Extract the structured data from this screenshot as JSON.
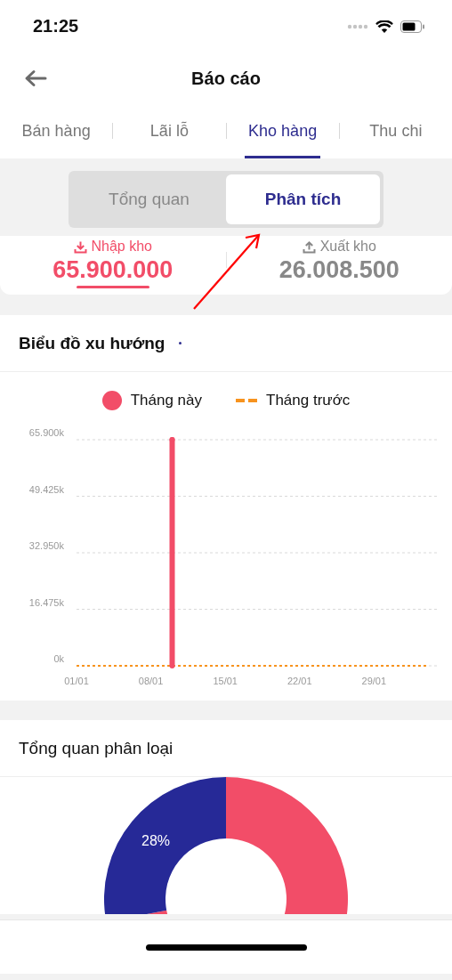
{
  "status_bar": {
    "time": "21:25"
  },
  "header": {
    "title": "Báo cáo"
  },
  "tabs": [
    {
      "label": "Bán hàng",
      "selected": false
    },
    {
      "label": "Lãi lỗ",
      "selected": false
    },
    {
      "label": "Kho hàng",
      "selected": true
    },
    {
      "label": "Thu chi",
      "selected": false
    }
  ],
  "segments": [
    {
      "label": "Tổng quan",
      "selected": false
    },
    {
      "label": "Phân tích",
      "selected": true
    }
  ],
  "summary": [
    {
      "kind": "import",
      "label": "Nhập kho",
      "value": "65.900.000",
      "selected": true
    },
    {
      "kind": "export",
      "label": "Xuất kho",
      "value": "26.008.500",
      "selected": false
    }
  ],
  "trend": {
    "title": "Biểu đồ xu hướng",
    "chart_data": {
      "type": "line",
      "categories": [
        "01/01",
        null,
        null,
        null,
        null,
        null,
        null,
        "08/01",
        null,
        null,
        null,
        null,
        null,
        null,
        "15/01",
        null,
        null,
        null,
        null,
        null,
        null,
        "22/01",
        null,
        null,
        null,
        null,
        null,
        null,
        "29/01",
        null,
        null,
        null,
        null,
        null
      ],
      "series": [
        {
          "name": "Tháng này",
          "color": "#f24d68",
          "line_style": "solid",
          "marker": "circle",
          "values": [
            null,
            null,
            null,
            null,
            null,
            null,
            null,
            null,
            null,
            65900,
            null,
            null,
            null,
            null,
            null,
            null,
            null,
            null,
            null,
            null,
            null,
            null,
            null,
            null,
            null,
            null,
            null,
            null,
            null,
            null,
            null,
            null,
            null,
            null
          ]
        },
        {
          "name": "Tháng trước",
          "color": "#f7931e",
          "line_style": "dashed",
          "values": [
            0,
            0,
            0,
            0,
            0,
            0,
            0,
            0,
            0,
            0,
            0,
            0,
            0,
            0,
            0,
            0,
            0,
            0,
            0,
            0,
            0,
            0,
            0,
            0,
            0,
            0,
            0,
            0,
            0,
            0,
            0,
            0,
            0,
            0
          ]
        }
      ],
      "ylim": [
        0,
        65900
      ],
      "grid": true,
      "yticks": [
        {
          "value": 0,
          "label": "0k"
        },
        {
          "value": 16475,
          "label": "16.475k"
        },
        {
          "value": 32950,
          "label": "32.950k"
        },
        {
          "value": 49425,
          "label": "49.425k"
        },
        {
          "value": 65900,
          "label": "65.900k"
        }
      ]
    }
  },
  "overview": {
    "title": "Tổng quan phân loại",
    "chart_data": {
      "type": "donut",
      "values": [
        72,
        28
      ],
      "colors": [
        "#f24d68",
        "#262997"
      ],
      "value_labels": [
        null,
        "28%"
      ]
    }
  }
}
